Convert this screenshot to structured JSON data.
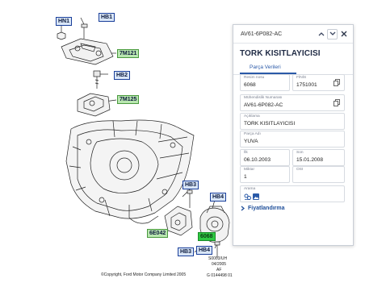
{
  "diagram": {
    "callouts": [
      {
        "id": "hn1",
        "text": "HN1"
      },
      {
        "id": "hb2",
        "text": "HB2"
      },
      {
        "id": "hb1",
        "text": "HB1"
      },
      {
        "id": "7m121",
        "text": "7M121"
      },
      {
        "id": "7m125",
        "text": "7M125"
      },
      {
        "id": "hb3",
        "text": "HB3"
      },
      {
        "id": "hb4a",
        "text": "HB4"
      },
      {
        "id": "6e042",
        "text": "6E042"
      },
      {
        "id": "6068",
        "text": "6068"
      },
      {
        "id": "hb3b",
        "text": "HB3"
      },
      {
        "id": "hb4b",
        "text": "HB4"
      }
    ],
    "copyright": "©Copyright, Ford Motor Company Limited 2005",
    "ref_lines": [
      "S0003/UH",
      "04/2005",
      "AF",
      "G 0144498 01"
    ]
  },
  "panel": {
    "header_code": "AV61-6P082-AC",
    "title": "TORK KISITLAYICISI",
    "tab_label": "Parça Verileri",
    "fields": {
      "image_no": {
        "label": "Resim nosu",
        "value": "6068"
      },
      "finis": {
        "label": "FİNİS",
        "value": "1751001"
      },
      "engineering_no": {
        "label": "Mühendislik Numarası",
        "value": "AV61-6P082-AC"
      },
      "description": {
        "label": "Açıklama",
        "value": "TORK KISITLAYICISI"
      },
      "part_name": {
        "label": "Parça Adı",
        "value": "YUVA"
      },
      "start": {
        "label": "İlk",
        "value": "06.10.2003"
      },
      "end": {
        "label": "Son",
        "value": "15.01.2008"
      },
      "quantity": {
        "label": "Miktar",
        "value": "1"
      },
      "osi": {
        "label": "OSI",
        "value": ""
      },
      "search": {
        "label": "Arama"
      }
    },
    "pricing_label": "Fiyatlandırma",
    "colors": {
      "accent": "#2b5aa8",
      "selected_callout": "#2ec842"
    }
  }
}
